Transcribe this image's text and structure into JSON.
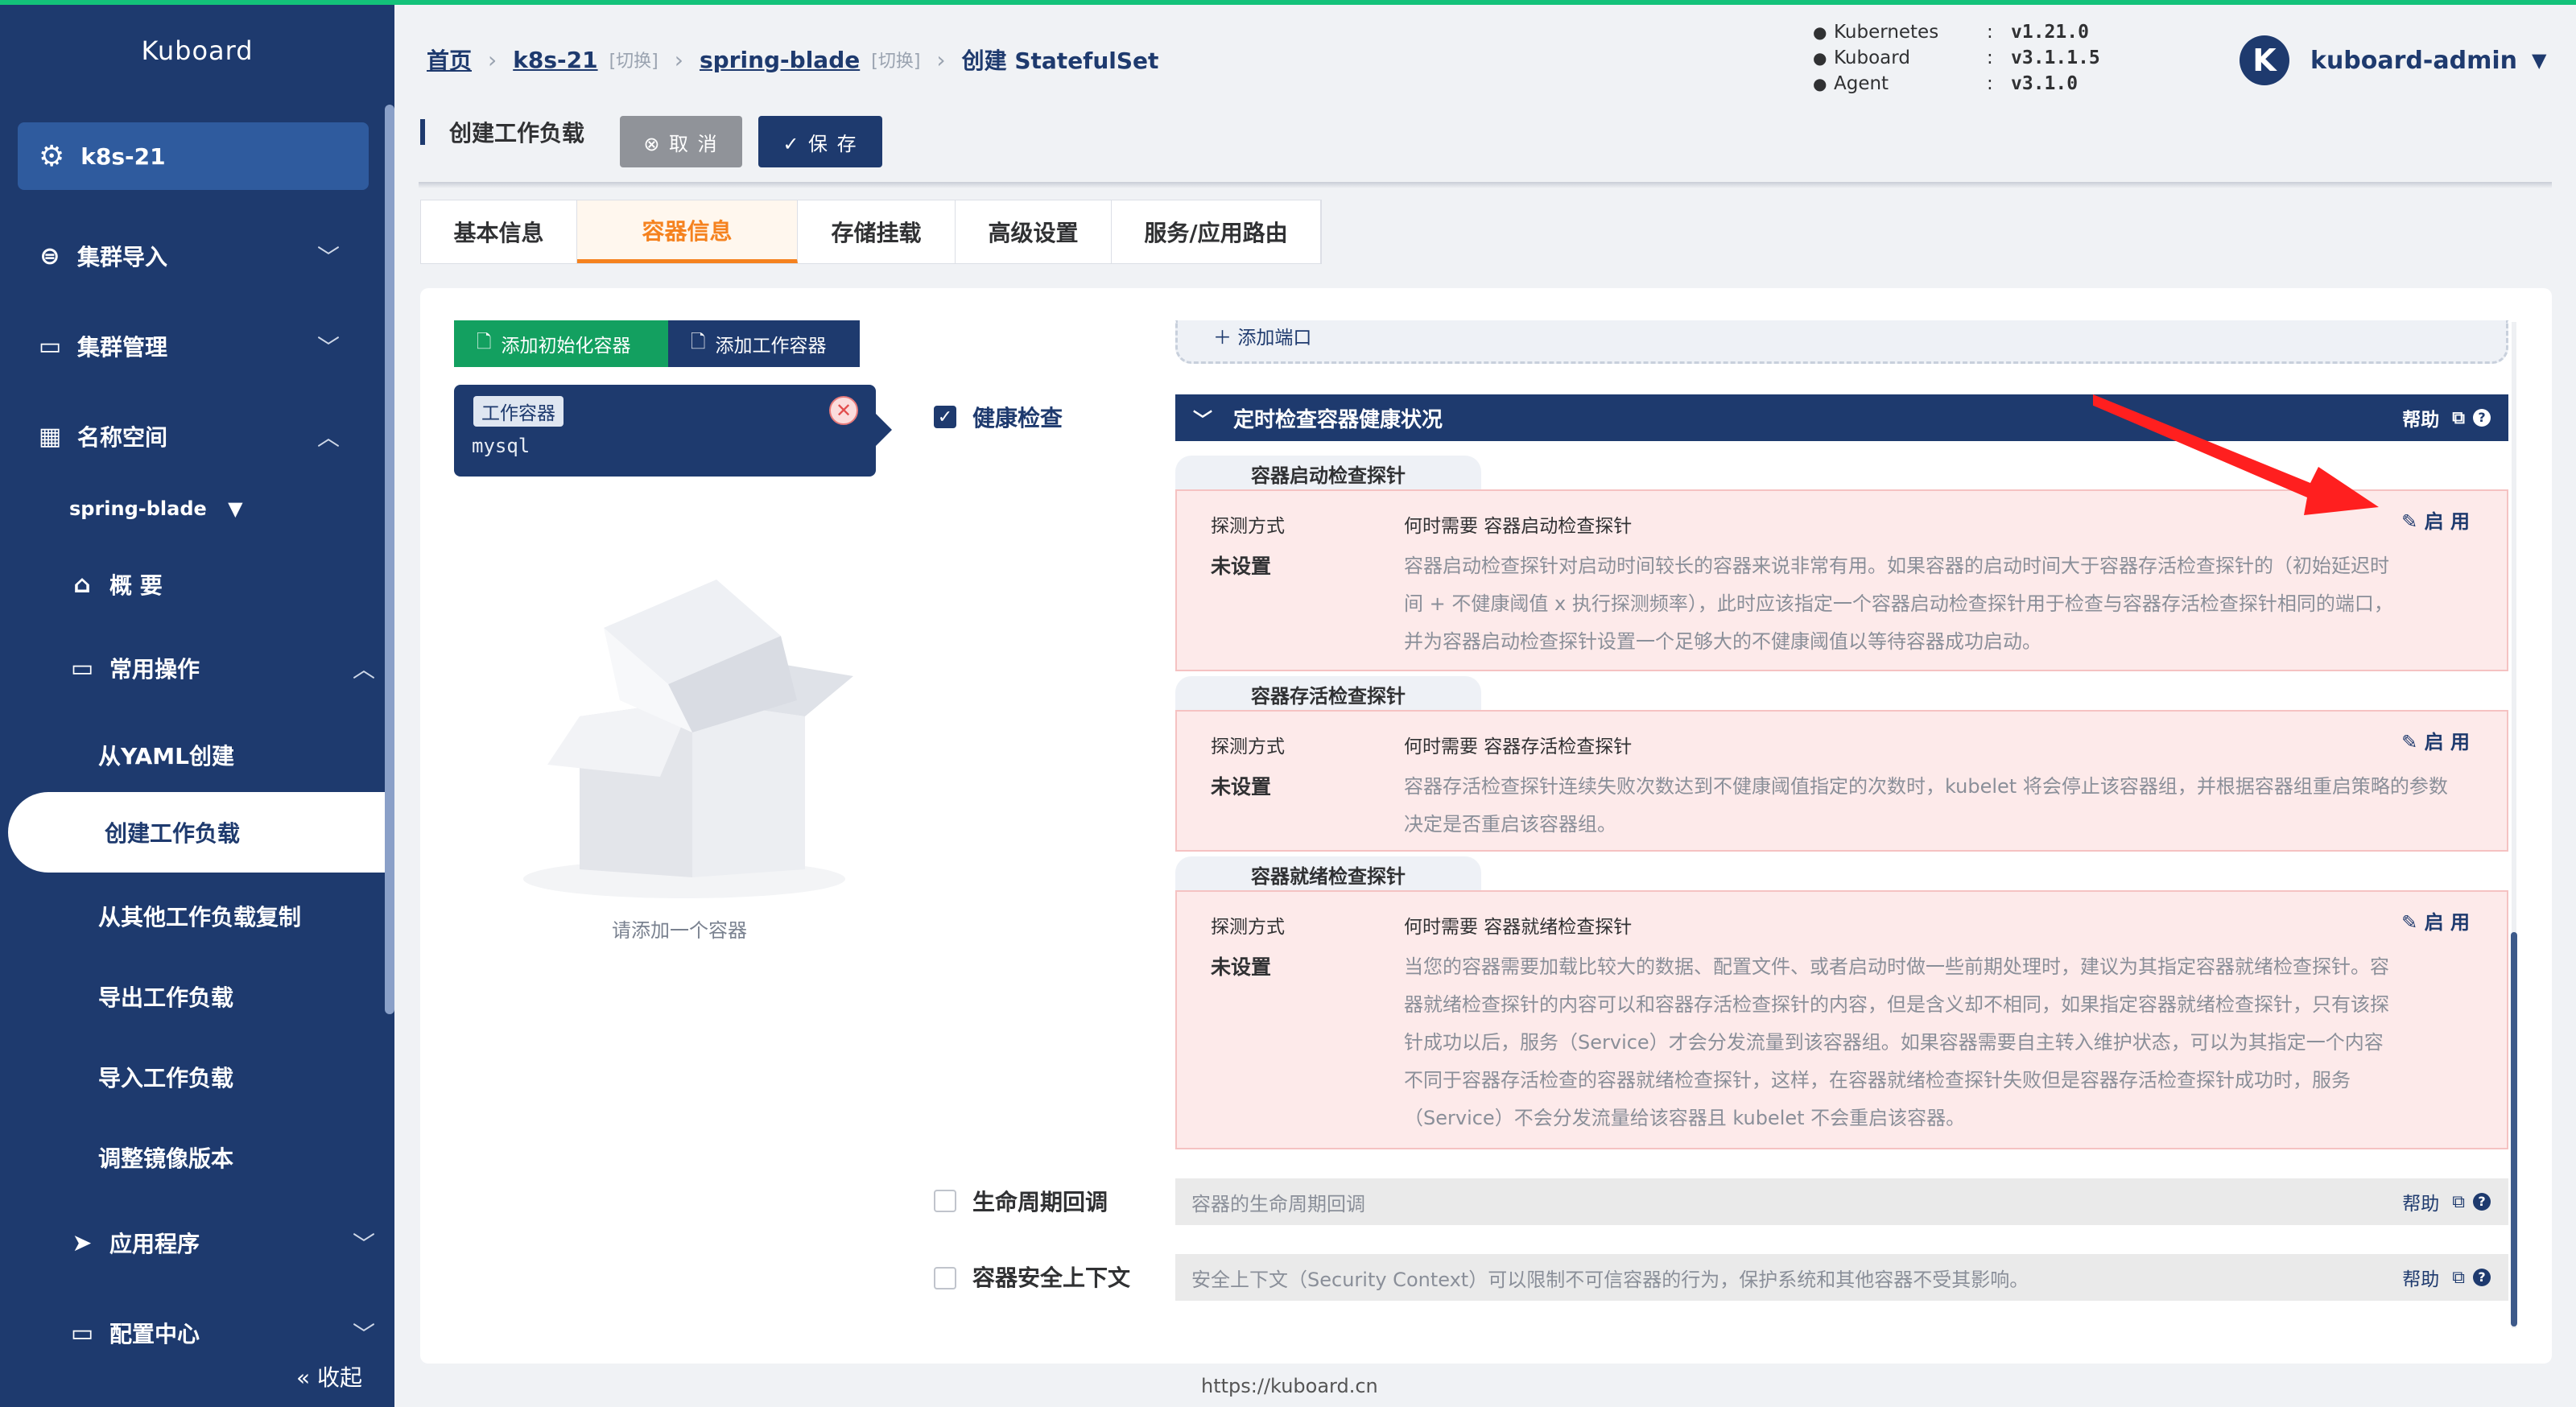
{
  "sidebar": {
    "logo": "Kuboard",
    "cluster": "k8s-21",
    "items": [
      {
        "label": "集群导入"
      },
      {
        "label": "集群管理"
      },
      {
        "label": "名称空间"
      }
    ],
    "namespace": "spring-blade",
    "overview": "概 要",
    "common_ops": "常用操作",
    "sub_items": [
      "从YAML创建",
      "创建工作负载",
      "从其他工作负载复制",
      "导出工作负载",
      "导入工作负载",
      "调整镜像版本"
    ],
    "apps": "应用程序",
    "config": "配置中心",
    "collapse": "收起"
  },
  "header": {
    "breadcrumb": {
      "home": "首页",
      "cluster": "k8s-21",
      "switch": "[切换]",
      "namespace": "spring-blade",
      "current": "创建 StatefulSet"
    },
    "versions": [
      {
        "name": "Kubernetes",
        "value": "v1.21.0"
      },
      {
        "name": "Kuboard",
        "value": "v3.1.1.5"
      },
      {
        "name": "Agent",
        "value": "v3.1.0"
      }
    ],
    "user": {
      "initial": "K",
      "name": "kuboard-admin"
    }
  },
  "toolbar": {
    "title": "创建工作负载",
    "cancel": "⊗ 取 消",
    "save": "✓ 保 存"
  },
  "tabs": [
    "基本信息",
    "容器信息",
    "存储挂载",
    "高级设置",
    "服务/应用路由"
  ],
  "containers": {
    "add_init": "添加初始化容器",
    "add_work": "添加工作容器",
    "card": {
      "tag": "工作容器",
      "name": "mysql"
    },
    "empty_text": "请添加一个容器"
  },
  "options": {
    "health": "健康检查",
    "lifecycle": "生命周期回调",
    "security": "容器安全上下文"
  },
  "port_add": "添加端口",
  "health": {
    "header": "定时检查容器健康状况",
    "help": "帮助",
    "probes": [
      {
        "tab": "容器启动检查探针",
        "key": "探测方式",
        "value": "未设置",
        "title": "何时需要 容器启动检查探针",
        "desc": "容器启动检查探针对启动时间较长的容器来说非常有用。如果容器的启动时间大于容器存活检查探针的（初始延迟时间 + 不健康阈值 x 执行探测频率），此时应该指定一个容器启动检查探针用于检查与容器存活检查探针相同的端口，并为容器启动检查探针设置一个足够大的不健康阈值以等待容器成功启动。",
        "enable": "启 用"
      },
      {
        "tab": "容器存活检查探针",
        "key": "探测方式",
        "value": "未设置",
        "title": "何时需要 容器存活检查探针",
        "desc": "容器存活检查探针连续失败次数达到不健康阈值指定的次数时，kubelet 将会停止该容器组，并根据容器组重启策略的参数决定是否重启该容器组。",
        "enable": "启 用"
      },
      {
        "tab": "容器就绪检查探针",
        "key": "探测方式",
        "value": "未设置",
        "title": "何时需要 容器就绪检查探针",
        "desc": "当您的容器需要加载比较大的数据、配置文件、或者启动时做一些前期处理时，建议为其指定容器就绪检查探针。容器就绪检查探针的内容可以和容器存活检查探针的内容，但是含义却不相同，如果指定容器就绪检查探针，只有该探针成功以后，服务（Service）才会分发流量到该容器组。如果容器需要自主转入维护状态，可以为其指定一个内容不同于容器存活检查的容器就绪检查探针，这样，在容器就绪检查探针失败但是容器存活检查探针成功时，服务（Service）不会分发流量给该容器且 kubelet 不会重启该容器。",
        "enable": "启 用"
      }
    ]
  },
  "lifecycle_bar": "容器的生命周期回调",
  "security_bar": "安全上下文（Security Context）可以限制不可信容器的行为，保护系统和其他容器不受其影响。",
  "footer": "https://kuboard.cn",
  "colors": {
    "navy": "#1e3a6e",
    "orange": "#f5821f",
    "green": "#13a060",
    "probe_bg": "#fdeaea",
    "arrow": "#ff1f1f"
  }
}
